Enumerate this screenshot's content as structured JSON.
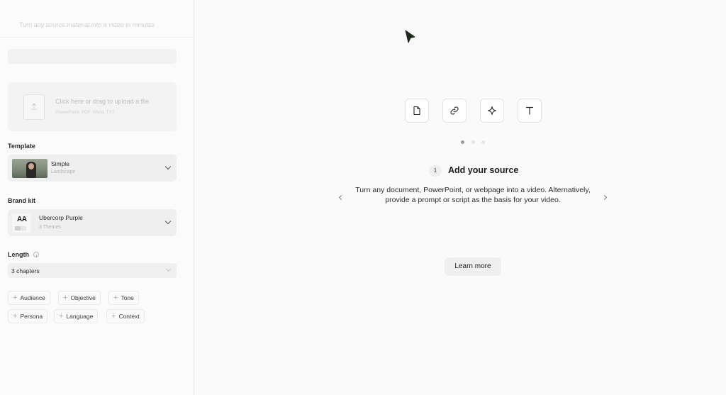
{
  "sidebar": {
    "subtitle": "Turn any source material into a video in minutes",
    "upload": {
      "title": "Click here or drag to upload a file",
      "formats": "PowerPoint, PDF, Word, TXT"
    },
    "template": {
      "label": "Template",
      "name": "Simple",
      "orientation": "Landscape"
    },
    "brand_kit": {
      "label": "Brand kit",
      "name": "Ubercorp Purple",
      "themes": "3 Themes",
      "logo_text": "AA"
    },
    "length": {
      "label": "Length",
      "value": "3 chapters"
    },
    "chips": [
      "Audience",
      "Objective",
      "Tone",
      "Persona",
      "Language",
      "Context"
    ]
  },
  "main": {
    "source_icons": [
      "document-icon",
      "link-icon",
      "sparkle-icon",
      "text-icon"
    ],
    "carousel": {
      "current": 1,
      "total": 3
    },
    "step": {
      "number": "1",
      "title": "Add your source",
      "description": "Turn any document, PowerPoint, or webpage into a video. Alternatively, provide a prompt or script as the basis for your video."
    },
    "learn_more": "Learn more"
  },
  "colors": {
    "background": "#fafafa",
    "sidebar_bg": "#fbfbfb",
    "button_bg": "#efefef",
    "text": "#1f1f1f"
  }
}
